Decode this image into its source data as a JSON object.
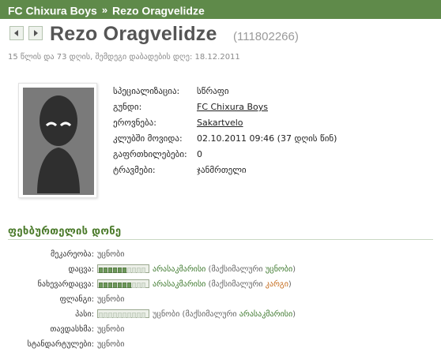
{
  "header": {
    "team": "FC Chixura Boys",
    "separator": "»",
    "player": "Rezo Oragvelidze"
  },
  "player": {
    "name": "Rezo Oragvelidze",
    "id": "(111802266)",
    "age_line": "15 წლის და 73 დღის, შემდეგი დაბადების დღე: 18.12.2011"
  },
  "info": {
    "specialty_label": "სპეციალიზაცია:",
    "specialty_value": "სწრაფი",
    "team_label": "გუნდი:",
    "team_value": "FC Chixura Boys",
    "nation_label": "ეროვნება:",
    "nation_value": "Sakartvelo",
    "arrived_label": "კლუბში მოვიდა:",
    "arrived_value": "02.10.2011 09:46 (37 დღის წინ)",
    "warnings_label": "გაფრთხილებები:",
    "warnings_value": "0",
    "injury_label": "ტრავმები:",
    "injury_value": "ჯანმრთელი"
  },
  "skills": {
    "heading": "ფეხბურთელის დონე",
    "rows": [
      {
        "label": "მეკარეობა:",
        "text": "უცნობი"
      },
      {
        "label": "დაცვა:",
        "filled": 6,
        "total": 10,
        "value": "არასაკმარისი",
        "prefix": " (მაქსიმალური ",
        "max": "უცნობი",
        "suffix": ")"
      },
      {
        "label": "ნახევარდაცვა:",
        "filled": 7,
        "total": 10,
        "value": "არასაკმარისი",
        "prefix": " (მაქსიმალური ",
        "max": "კარგი",
        "suffix": ")"
      },
      {
        "label": "ფლანგი:",
        "text": "უცნობი"
      },
      {
        "label": "პასი:",
        "filled": 0,
        "total": 10,
        "value": "უცნობი",
        "prefix": " (მაქსიმალური ",
        "max": "არასაკმარისი",
        "suffix": ")"
      },
      {
        "label": "თავდასხმა:",
        "text": "უცნობი"
      },
      {
        "label": "სტანდარტულები:",
        "text": "უცნობი"
      }
    ]
  },
  "colors": {
    "topbar": "#5f8a4a",
    "link": "#3f7a2f",
    "heading": "#4a7a2a",
    "orange": "#c46a1a",
    "bar_fill": "#6f9a5c"
  },
  "icons": {
    "prev": "arrow-left-icon",
    "next": "arrow-right-icon"
  }
}
